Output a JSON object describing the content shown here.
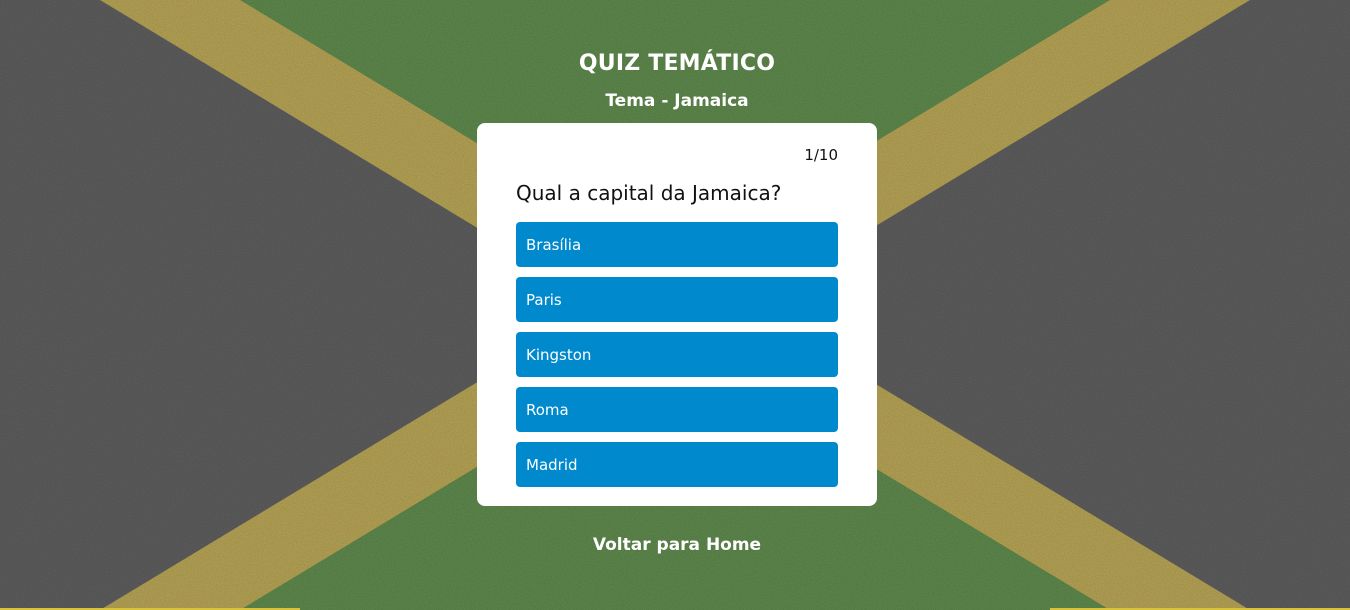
{
  "header": {
    "title": "QUIZ TEMÁTICO",
    "subtitle": "Tema - Jamaica"
  },
  "quiz": {
    "counter": "1/10",
    "question": "Qual a capital da Jamaica?",
    "options": [
      {
        "label": "Brasília"
      },
      {
        "label": "Paris"
      },
      {
        "label": "Kingston"
      },
      {
        "label": "Roma"
      },
      {
        "label": "Madrid"
      }
    ]
  },
  "footer": {
    "home_link": "Voltar para Home"
  },
  "colors": {
    "option_bg": "#0089cc",
    "card_bg": "#ffffff",
    "flag_black": "#5e5e5e",
    "flag_gold": "#b8a556",
    "flag_green": "#5f8a4d"
  }
}
